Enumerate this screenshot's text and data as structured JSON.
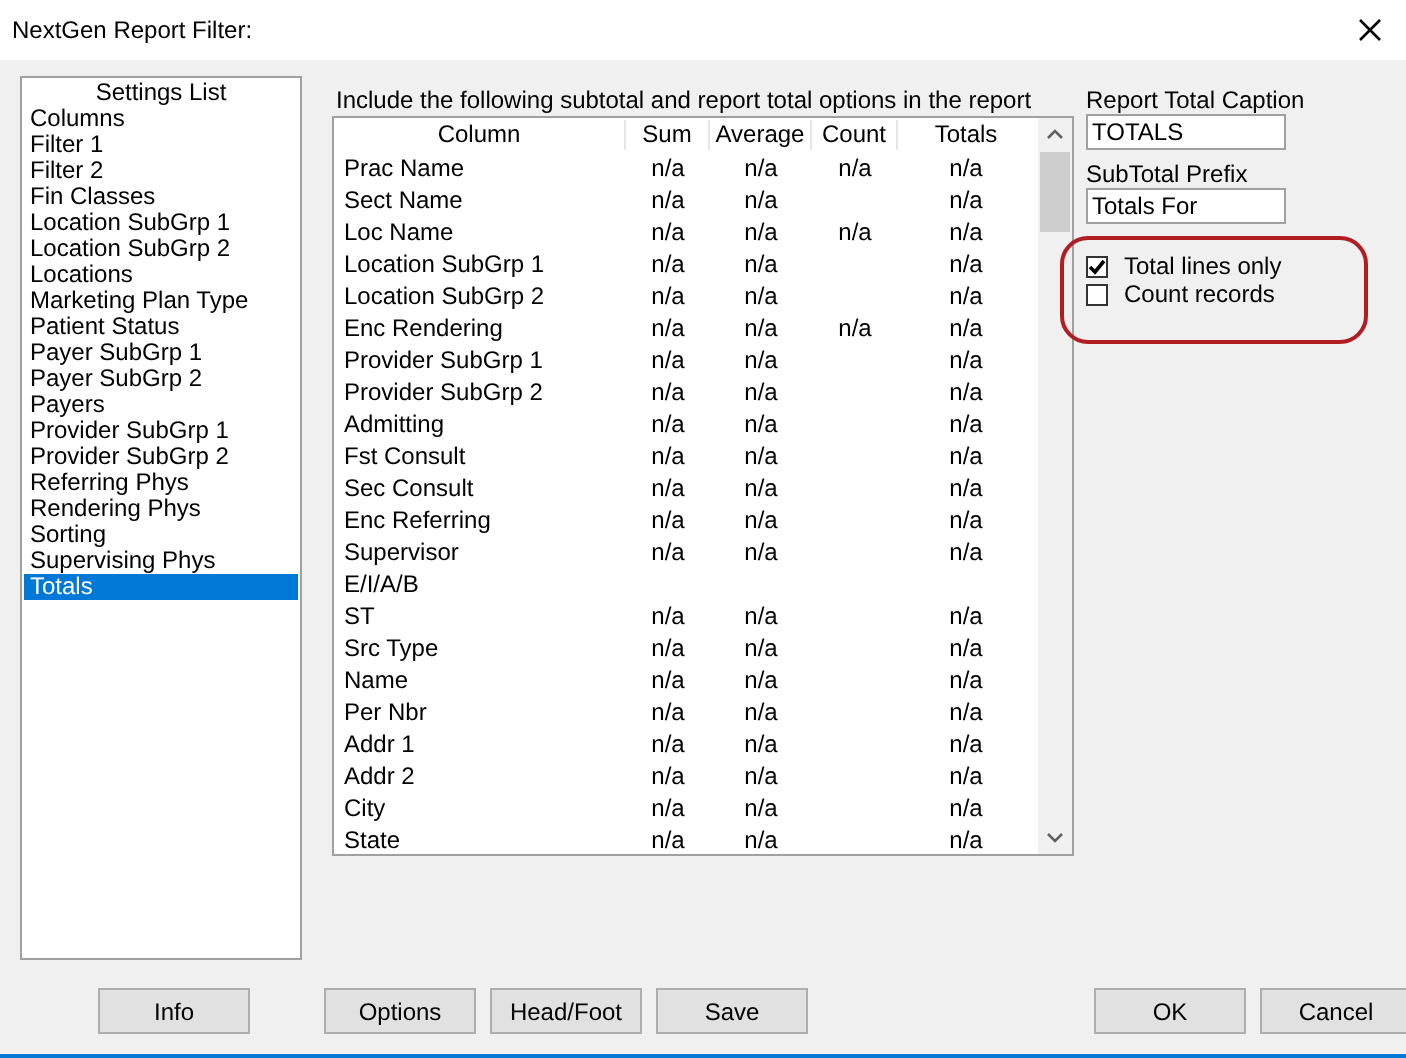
{
  "window": {
    "title": "NextGen Report Filter:"
  },
  "settings_list": {
    "heading": "Settings List",
    "items": [
      {
        "label": "Columns",
        "selected": false
      },
      {
        "label": "Filter 1",
        "selected": false
      },
      {
        "label": "Filter 2",
        "selected": false
      },
      {
        "label": "Fin Classes",
        "selected": false
      },
      {
        "label": "Location SubGrp 1",
        "selected": false
      },
      {
        "label": "Location SubGrp 2",
        "selected": false
      },
      {
        "label": "Locations",
        "selected": false
      },
      {
        "label": "Marketing Plan Type",
        "selected": false
      },
      {
        "label": "Patient Status",
        "selected": false
      },
      {
        "label": "Payer SubGrp 1",
        "selected": false
      },
      {
        "label": "Payer SubGrp 2",
        "selected": false
      },
      {
        "label": "Payers",
        "selected": false
      },
      {
        "label": "Provider SubGrp 1",
        "selected": false
      },
      {
        "label": "Provider SubGrp 2",
        "selected": false
      },
      {
        "label": "Referring Phys",
        "selected": false
      },
      {
        "label": "Rendering Phys",
        "selected": false
      },
      {
        "label": "Sorting",
        "selected": false
      },
      {
        "label": "Supervising Phys",
        "selected": false
      },
      {
        "label": "Totals",
        "selected": true
      }
    ]
  },
  "options": {
    "instruction": "Include the following subtotal and report total options in the report",
    "table": {
      "columns": [
        "Column",
        "Sum",
        "Average",
        "Count",
        "Totals"
      ],
      "rows": [
        {
          "name": "Prac Name",
          "sum": "n/a",
          "average": "n/a",
          "count": "n/a",
          "totals": "n/a"
        },
        {
          "name": "Sect Name",
          "sum": "n/a",
          "average": "n/a",
          "totals": "n/a"
        },
        {
          "name": "Loc Name",
          "sum": "n/a",
          "average": "n/a",
          "count": "n/a",
          "totals": "n/a"
        },
        {
          "name": "Location SubGrp 1",
          "sum": "n/a",
          "average": "n/a",
          "totals": "n/a"
        },
        {
          "name": "Location SubGrp 2",
          "sum": "n/a",
          "average": "n/a",
          "totals": "n/a"
        },
        {
          "name": "Enc Rendering",
          "sum": "n/a",
          "average": "n/a",
          "count": "n/a",
          "totals": "n/a"
        },
        {
          "name": "Provider SubGrp 1",
          "sum": "n/a",
          "average": "n/a",
          "totals": "n/a"
        },
        {
          "name": "Provider SubGrp 2",
          "sum": "n/a",
          "average": "n/a",
          "totals": "n/a"
        },
        {
          "name": "Admitting",
          "sum": "n/a",
          "average": "n/a",
          "totals": "n/a"
        },
        {
          "name": "Fst Consult",
          "sum": "n/a",
          "average": "n/a",
          "totals": "n/a"
        },
        {
          "name": "Sec Consult",
          "sum": "n/a",
          "average": "n/a",
          "totals": "n/a"
        },
        {
          "name": "Enc Referring",
          "sum": "n/a",
          "average": "n/a",
          "totals": "n/a"
        },
        {
          "name": "Supervisor",
          "sum": "n/a",
          "average": "n/a",
          "totals": "n/a"
        },
        {
          "name": "E/I/A/B"
        },
        {
          "name": "ST",
          "sum": "n/a",
          "average": "n/a",
          "totals": "n/a"
        },
        {
          "name": "Src Type",
          "sum": "n/a",
          "average": "n/a",
          "totals": "n/a"
        },
        {
          "name": "Name",
          "sum": "n/a",
          "average": "n/a",
          "totals": "n/a"
        },
        {
          "name": "Per Nbr",
          "sum": "n/a",
          "average": "n/a",
          "totals": "n/a"
        },
        {
          "name": "Addr 1",
          "sum": "n/a",
          "average": "n/a",
          "totals": "n/a"
        },
        {
          "name": "Addr 2",
          "sum": "n/a",
          "average": "n/a",
          "totals": "n/a"
        },
        {
          "name": "City",
          "sum": "n/a",
          "average": "n/a",
          "totals": "n/a"
        },
        {
          "name": "State",
          "sum": "n/a",
          "average": "n/a",
          "totals": "n/a"
        }
      ]
    }
  },
  "report_total_caption": {
    "label": "Report Total Caption",
    "value": "TOTALS"
  },
  "subtotal_prefix": {
    "label": "SubTotal Prefix",
    "value": "Totals For"
  },
  "checkboxes": [
    {
      "label": "Total lines only",
      "checked": true
    },
    {
      "label": "Count records",
      "checked": false
    }
  ],
  "buttons_left": [
    "Info",
    "Options",
    "Head/Foot",
    "Save"
  ],
  "buttons_right": [
    "OK",
    "Cancel"
  ]
}
